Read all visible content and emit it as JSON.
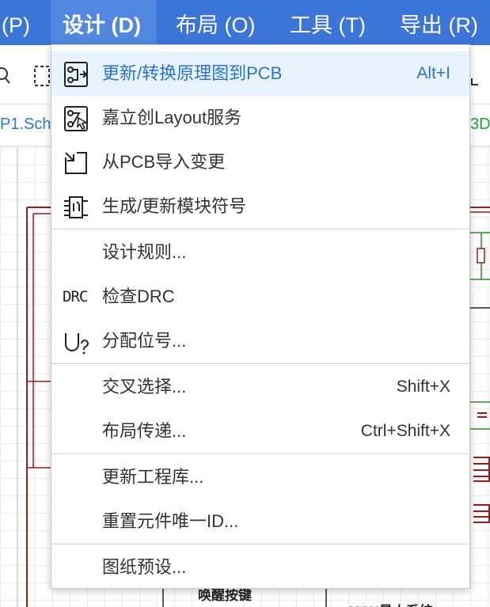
{
  "menubar": {
    "items": [
      {
        "label": "(P)"
      },
      {
        "label": "设计 (D)"
      },
      {
        "label": "布局 (O)"
      },
      {
        "label": "工具 (T)"
      },
      {
        "label": "导出 (R)"
      }
    ]
  },
  "tabs": {
    "left_label": "P1.Sch",
    "right_label": "3D"
  },
  "canvas": {
    "bottom_left_text": "唤醒按键",
    "bottom_right_text": "MCU最小系统"
  },
  "design_menu": {
    "items": [
      {
        "label": "更新/转换原理图到PCB",
        "shortcut": "Alt+I",
        "icon": "schematic-to-pcb-icon"
      },
      {
        "label": "嘉立创Layout服务",
        "icon": "layout-service-icon"
      },
      {
        "label": "从PCB导入变更",
        "icon": "import-changes-icon"
      },
      {
        "label": "生成/更新模块符号",
        "icon": "module-symbol-icon"
      },
      {
        "label": "设计规则..."
      },
      {
        "label": "检查DRC",
        "icon_text": "DRC"
      },
      {
        "label": "分配位号...",
        "icon": "assign-designator-icon"
      },
      {
        "label": "交叉选择...",
        "shortcut": "Shift+X"
      },
      {
        "label": "布局传递...",
        "shortcut": "Ctrl+Shift+X"
      },
      {
        "label": "更新工程库..."
      },
      {
        "label": "重置元件唯一ID..."
      },
      {
        "label": "图纸预设..."
      }
    ]
  },
  "colors": {
    "menubar_bg": "#3c75d8",
    "menu_highlight_bg": "#e8f3fd",
    "menu_highlight_text": "#2875d7",
    "wire_red": "#9b1c1c",
    "wire_green": "#2e8b2e"
  }
}
